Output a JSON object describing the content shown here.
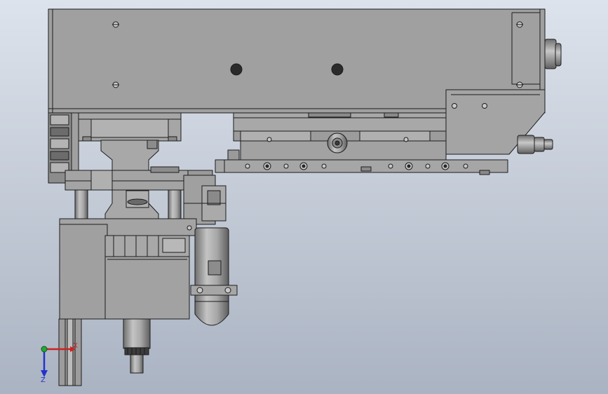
{
  "colors": {
    "background_top": "#dde3ec",
    "background_bottom": "#aab3c2",
    "part_fill": "#9c9c9c",
    "part_light": "#b2b2b2",
    "part_dark": "#7a7a7a",
    "edge": "#1c1c1c",
    "hole": "#2b2b2b",
    "axis_x": "#cc2222",
    "axis_y": "#22aa33",
    "axis_z": "#2233cc"
  },
  "triad": {
    "x_label": "X",
    "z_label": "Z"
  }
}
